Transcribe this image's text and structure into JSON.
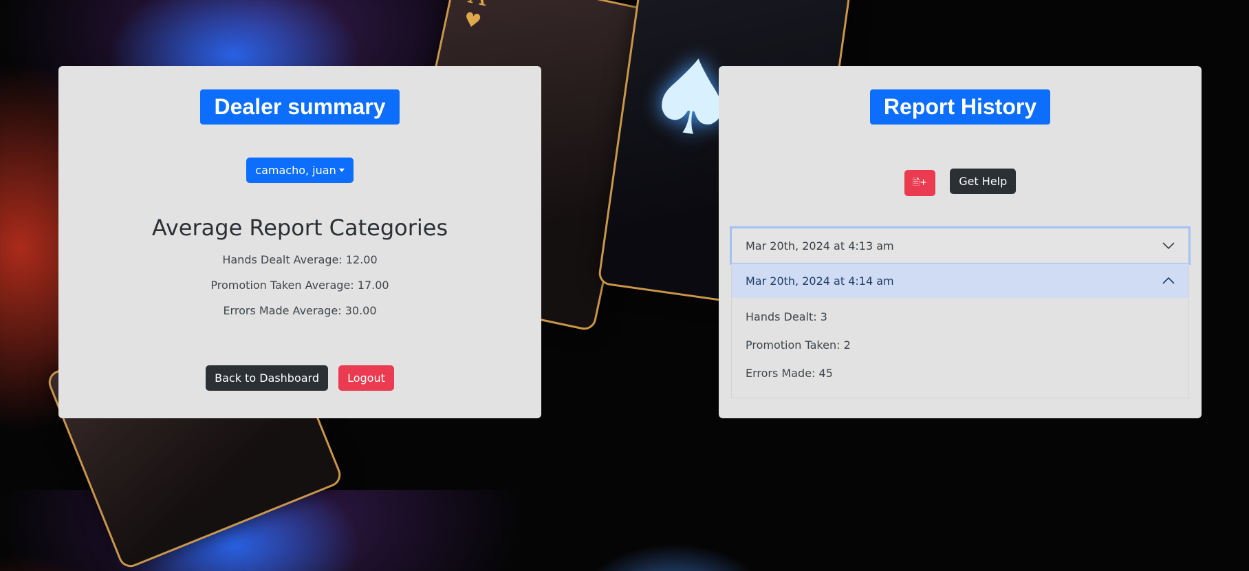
{
  "colors": {
    "primary": "#0d6efd",
    "dark": "#2b3035",
    "danger": "#eb3b50",
    "panel": "#e2e2e2"
  },
  "dealer_panel": {
    "title": "Dealer summary",
    "dealer_select_label": "camacho, juan",
    "heading": "Average Report Categories",
    "averages": [
      "Hands Dealt Average: 12.00",
      "Promotion Taken Average: 17.00",
      "Errors Made Average: 30.00"
    ],
    "back_button": "Back to Dashboard",
    "logout_button": "Logout"
  },
  "history_panel": {
    "title": "Report History",
    "new_report_icon": "file-plus-icon",
    "new_report_glyph": "🗎+",
    "help_button": "Get Help",
    "reports": [
      {
        "date": "Mar 20th, 2024 at 4:13 am",
        "expanded": false
      },
      {
        "date": "Mar 20th, 2024 at 4:14 am",
        "expanded": true,
        "details": [
          "Hands Dealt: 3",
          "Promotion Taken: 2",
          "Errors Made: 45"
        ]
      }
    ]
  }
}
